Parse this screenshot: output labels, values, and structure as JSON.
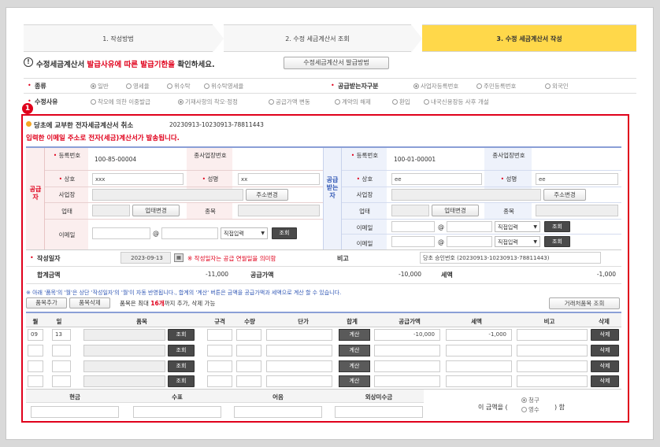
{
  "steps": [
    {
      "label": "1. 작성방법"
    },
    {
      "label": "2. 수정 세금계산서 조회"
    },
    {
      "label": "3. 수정 세금계산서 작성"
    }
  ],
  "notice": {
    "icon": "exclamation-circle-icon",
    "prefix": "수정세금계산서",
    "highlight": "발급사유에 따른 발급기한을",
    "suffix": "확인하세요.",
    "button": "수정세금계산서 발급방법"
  },
  "type_row": {
    "label": "종류",
    "options": [
      "일반",
      "영세율",
      "위수탁",
      "위수탁영세율"
    ],
    "selected": "일반",
    "receiver_label": "공급받는자구분",
    "receiver_options": [
      "사업자등록번호",
      "주민등록번호",
      "외국인"
    ],
    "receiver_selected": "사업자등록번호"
  },
  "reason_row": {
    "label": "수정사유",
    "options": [
      "착오에 의한 이중발급",
      "기재사항의 착오·정정",
      "공급가액 변동",
      "계약의 해제",
      "환입",
      "내국신용장등 사후 개설"
    ],
    "selected": "기재사항의 착오·정정"
  },
  "badge": "1",
  "cancel": {
    "title": "당초에 교부한 전자세금계산서 취소",
    "number": "20230913-10230913-78811443",
    "warning": "입력한 이메일 주소로 전자(세금)계산서가 발송됩니다."
  },
  "supplier": {
    "side_label": "공급자",
    "reg_label": "등록번호",
    "reg_no": "100-85-00004",
    "sub_label": "종사업장번호",
    "name_label": "상호",
    "name": "xxx",
    "rep_label": "성명",
    "rep": "xx",
    "addr_label": "사업장",
    "addr_btn": "주소변경",
    "biz_label": "업태",
    "biz_btn": "업태변경",
    "item_label": "종목",
    "email_label": "이메일",
    "at": "@",
    "direct": "직접입력",
    "lookup": "조회"
  },
  "receiver": {
    "side_label": "공급받는자",
    "reg_label": "등록번호",
    "reg_no": "100-01-00001",
    "sub_label": "종사업장번호",
    "name_label": "상호",
    "name": "ee",
    "rep_label": "성명",
    "rep": "ee",
    "addr_label": "사업장",
    "addr_btn": "주소변경",
    "biz_label": "업태",
    "biz_btn": "업태변경",
    "item_label": "종목",
    "email_label": "이메일",
    "at": "@",
    "direct": "직접입력",
    "lookup": "조회"
  },
  "date_row": {
    "label": "작성일자",
    "value": "2023-09-13",
    "note": "※ 작성일자는 공급 연월일을 의미함",
    "memo_label": "비고",
    "memo": "당초 승인번호 (20230913-10230913-78811443)"
  },
  "total_row": {
    "total_label": "합계금액",
    "total": "-11,000",
    "supply_label": "공급가액",
    "supply": "-10,000",
    "tax_label": "세액",
    "tax": "-1,000"
  },
  "item_note": "※ 아래 '품목'의 '월'은 상단 '작성일자'의 '월'이 자동 반영됩니다., 합계의 '계산' 버튼은 금액을 공급가액과 세액으로 계산 할 수 있습니다.",
  "item_controls": {
    "add": "품목추가",
    "del": "품목삭제",
    "limit_a": "품목은 최대",
    "limit_b": "16개",
    "limit_c": "까지 추가, 삭제 가능",
    "lookup": "거래처품목 조회"
  },
  "table": {
    "headers": [
      "월",
      "일",
      "품목",
      "규격",
      "수량",
      "단가",
      "합계",
      "공급가액",
      "세액",
      "비고",
      "삭제"
    ],
    "rows": [
      {
        "month": "09",
        "day": "13",
        "supply": "-10,000",
        "tax": "-1,000"
      },
      {
        "month": "",
        "day": "",
        "supply": "",
        "tax": ""
      },
      {
        "month": "",
        "day": "",
        "supply": "",
        "tax": ""
      },
      {
        "month": "",
        "day": "",
        "supply": "",
        "tax": ""
      }
    ],
    "lookup_btn": "조회",
    "calc_btn": "계산",
    "del_btn": "삭제"
  },
  "payment": {
    "headers": [
      "현금",
      "수표",
      "어음",
      "외상미수금"
    ],
    "amount_prefix": "이 금액을 (",
    "opt1": "청구",
    "opt2": "영수",
    "amount_suffix": ") 함"
  }
}
